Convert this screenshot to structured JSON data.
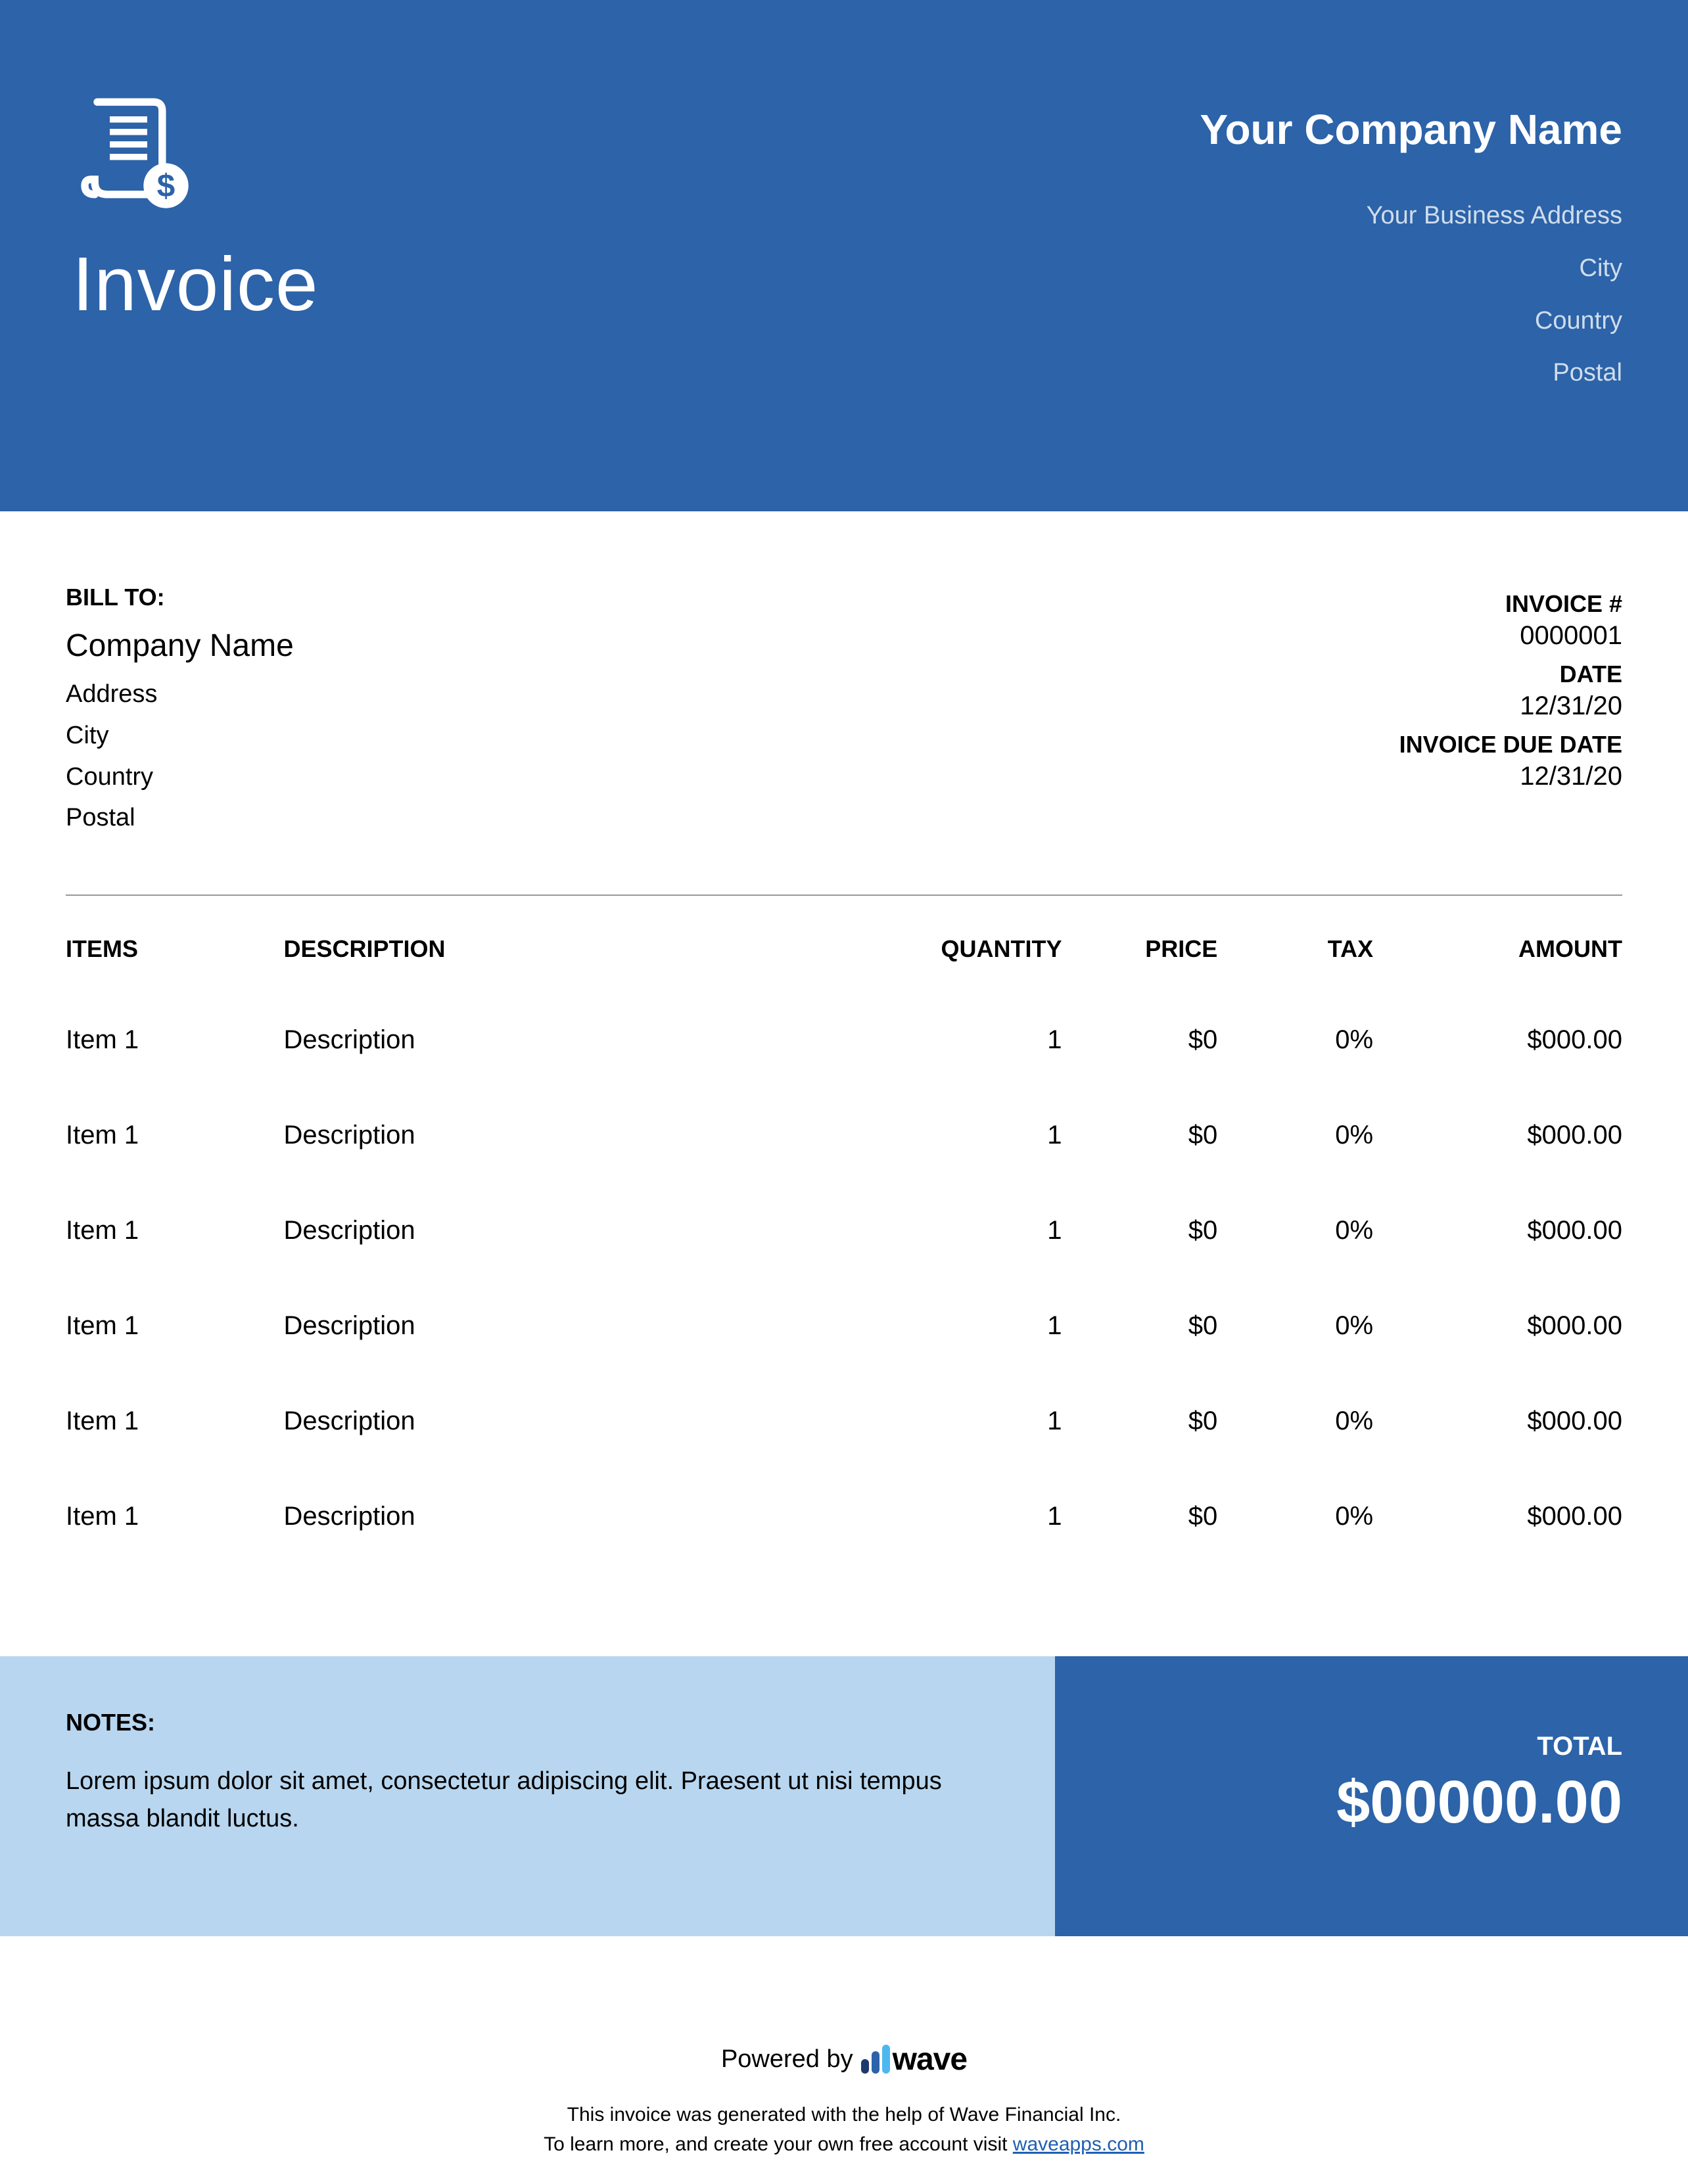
{
  "header": {
    "title": "Invoice",
    "company": "Your Company Name",
    "address": "Your Business Address",
    "city": "City",
    "country": "Country",
    "postal": "Postal"
  },
  "bill_to": {
    "label": "BILL TO:",
    "company": "Company Name",
    "address": "Address",
    "city": "City",
    "country": "Country",
    "postal": "Postal"
  },
  "meta": {
    "invoice_label": "INVOICE #",
    "invoice_value": "0000001",
    "date_label": "DATE",
    "date_value": "12/31/20",
    "due_label": "INVOICE DUE DATE",
    "due_value": "12/31/20"
  },
  "columns": {
    "items": "ITEMS",
    "description": "DESCRIPTION",
    "quantity": "QUANTITY",
    "price": "PRICE",
    "tax": "TAX",
    "amount": "AMOUNT"
  },
  "items": [
    {
      "item": "Item 1",
      "description": "Description",
      "quantity": "1",
      "price": "$0",
      "tax": "0%",
      "amount": "$000.00"
    },
    {
      "item": "Item 1",
      "description": "Description",
      "quantity": "1",
      "price": "$0",
      "tax": "0%",
      "amount": "$000.00"
    },
    {
      "item": "Item 1",
      "description": "Description",
      "quantity": "1",
      "price": "$0",
      "tax": "0%",
      "amount": "$000.00"
    },
    {
      "item": "Item 1",
      "description": "Description",
      "quantity": "1",
      "price": "$0",
      "tax": "0%",
      "amount": "$000.00"
    },
    {
      "item": "Item 1",
      "description": "Description",
      "quantity": "1",
      "price": "$0",
      "tax": "0%",
      "amount": "$000.00"
    },
    {
      "item": "Item 1",
      "description": "Description",
      "quantity": "1",
      "price": "$0",
      "tax": "0%",
      "amount": "$000.00"
    }
  ],
  "notes": {
    "label": "NOTES:",
    "text": "Lorem ipsum dolor sit amet, consectetur adipiscing elit. Praesent ut nisi tempus massa blandit luctus."
  },
  "total": {
    "label": "TOTAL",
    "value": "$00000.00"
  },
  "powered": {
    "prefix": "Powered by",
    "brand": "wave",
    "disclaimer1": "This invoice was generated with the help of Wave Financial Inc.",
    "disclaimer2": "To learn more, and create your own free account visit ",
    "link": "waveapps.com"
  }
}
